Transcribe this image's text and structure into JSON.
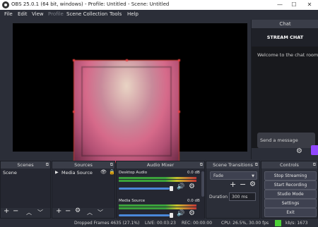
{
  "window": {
    "title": "OBS 25.0.1 (64 bit, windows) - Profile: Untitled - Scene: Untitled",
    "minimize": "—",
    "maximize": "☐",
    "close": "✕"
  },
  "menu": {
    "items": [
      "File",
      "Edit",
      "View",
      "Profile",
      "Scene Collection",
      "Tools",
      "Help"
    ]
  },
  "chat": {
    "dock_title": "Chat",
    "title": "STREAM CHAT",
    "welcome": "Welcome to the chat room!",
    "input_placeholder": "Send a message"
  },
  "scenes": {
    "title": "Scenes",
    "items": [
      "Scene"
    ]
  },
  "sources": {
    "title": "Sources",
    "items": [
      "Media Source"
    ]
  },
  "audio_mixer": {
    "title": "Audio Mixer",
    "channels": [
      {
        "name": "Desktop Audio",
        "db": "0.0 dB",
        "level": 0.75
      },
      {
        "name": "Media Source",
        "db": "0.0 dB",
        "level": 0.75
      }
    ]
  },
  "transitions": {
    "title": "Scene Transitions",
    "selected": "Fade",
    "duration_label": "Duration",
    "duration_value": "300 ms"
  },
  "controls": {
    "title": "Controls",
    "buttons": [
      "Stop Streaming",
      "Start Recording",
      "Studio Mode",
      "Settings",
      "Exit"
    ]
  },
  "status": {
    "dropped": "Dropped Frames 4635 (27.1%)",
    "live": "LIVE: 00:03:23",
    "rec": "REC: 00:00:00",
    "cpu": "CPU: 26.5%, 30.00 fps",
    "kbps": "kb/s: 1673",
    "indicator_color": "#4cd137"
  },
  "icons": {
    "chat_settings": "gear-icon",
    "volume": "speaker-icon",
    "eye": "eye-icon",
    "lock": "lock-icon"
  }
}
